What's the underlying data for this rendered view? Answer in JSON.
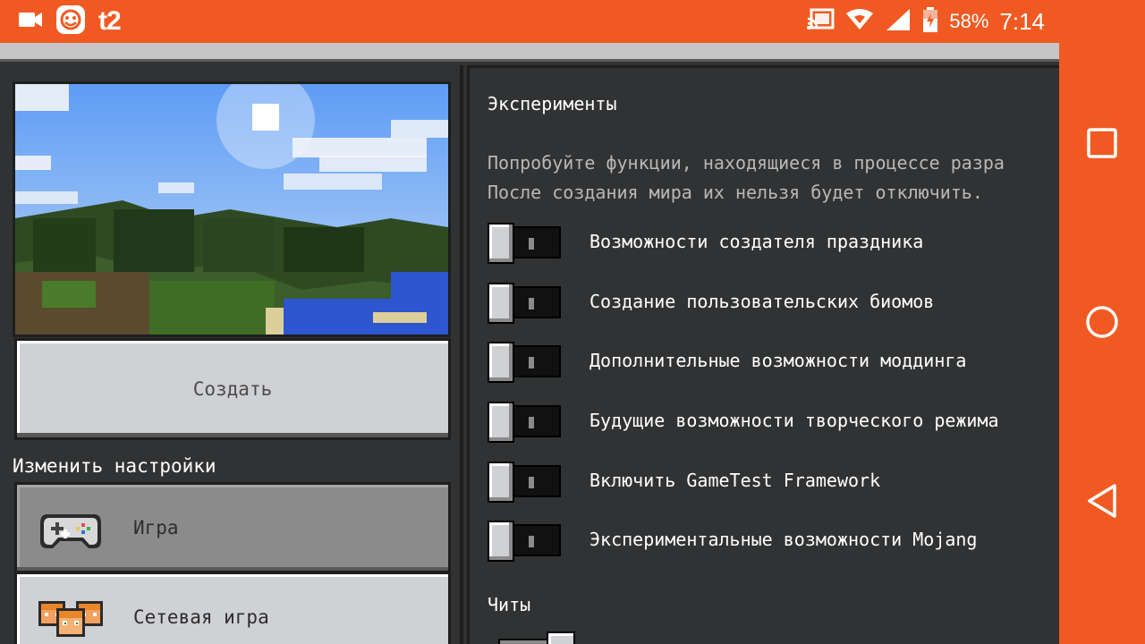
{
  "status_bar": {
    "carrier": "t2",
    "battery": "58%",
    "time": "7:14",
    "icons": [
      "video-camera-icon",
      "app-face-icon",
      "cast-icon",
      "wifi-icon",
      "signal-icon",
      "battery-charging-icon"
    ]
  },
  "left_panel": {
    "create_button": "Создать",
    "settings_title": "Изменить настройки",
    "tabs": [
      {
        "label": "Игра",
        "icon": "controller-icon",
        "active": true
      },
      {
        "label": "Сетевая игра",
        "icon": "multiplayer-icon",
        "active": false
      }
    ]
  },
  "experiments": {
    "title": "Эксперименты",
    "description_line1": "Попробуйте функции, находящиеся в процессе разра",
    "description_line2": "После создания мира их нельзя будет отключить.",
    "toggles": [
      {
        "label": "Возможности создателя праздника",
        "on": false
      },
      {
        "label": "Создание пользовательских биомов",
        "on": false
      },
      {
        "label": "Дополнительные возможности моддинга",
        "on": false
      },
      {
        "label": "Будущие возможности творческого режима",
        "on": false
      },
      {
        "label": "Включить GameTest Framework",
        "on": false
      },
      {
        "label": "Экспериментальные возможности Mojang",
        "on": false
      }
    ]
  },
  "cheats": {
    "title": "Читы",
    "on": true
  },
  "nav_bar": {
    "buttons": [
      "recent-apps-icon",
      "home-icon",
      "back-icon"
    ]
  },
  "colors": {
    "system_orange": "#f05a22",
    "panel_dark": "#313233",
    "button_light": "#d0d1d4"
  }
}
